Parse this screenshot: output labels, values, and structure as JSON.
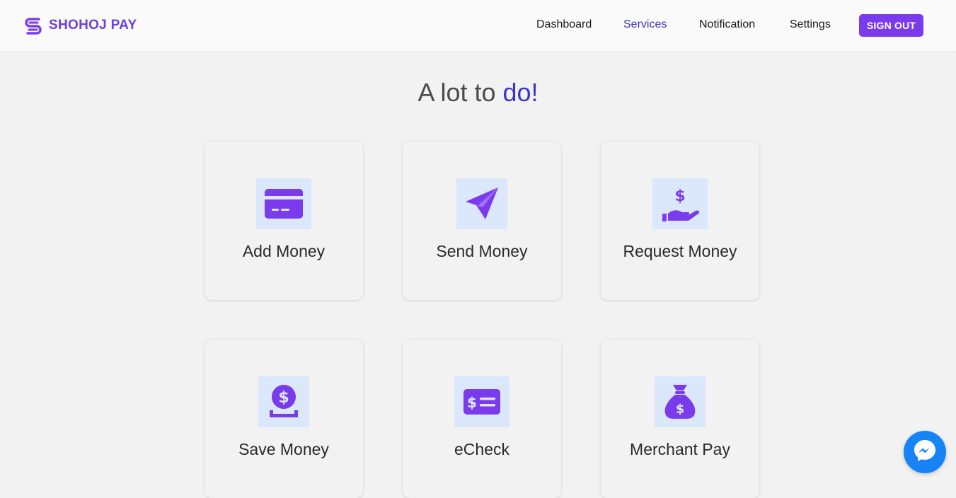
{
  "brand": {
    "name": "SHOHOJ PAY",
    "color": "#6b3fe0"
  },
  "nav": {
    "links": [
      {
        "label": "Dashboard",
        "active": false
      },
      {
        "label": "Services",
        "active": true
      },
      {
        "label": "Notification",
        "active": false
      },
      {
        "label": "Settings",
        "active": false
      }
    ],
    "signout_label": "SIGN OUT"
  },
  "heading": {
    "text": "A lot to ",
    "accent": "do!"
  },
  "services": [
    {
      "label": "Add Money",
      "icon": "credit-card-icon"
    },
    {
      "label": "Send Money",
      "icon": "paper-plane-icon"
    },
    {
      "label": "Request Money",
      "icon": "hand-holding-dollar-icon"
    },
    {
      "label": "Save Money",
      "icon": "dollar-coin-deposit-icon"
    },
    {
      "label": "eCheck",
      "icon": "money-check-icon"
    },
    {
      "label": "Merchant Pay",
      "icon": "money-bag-icon"
    }
  ],
  "colors": {
    "accent": "#7c3aed",
    "active_nav": "#3b34b6",
    "icon_bg": "#dbe8fb",
    "messenger": "#1684f5"
  },
  "chat": {
    "icon": "messenger-icon"
  }
}
